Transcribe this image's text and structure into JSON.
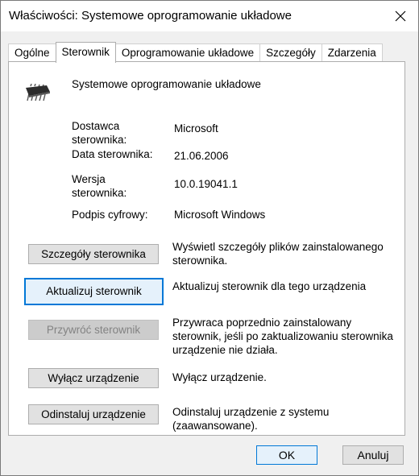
{
  "window": {
    "title": "Właściwości: Systemowe oprogramowanie układowe"
  },
  "tabs": [
    {
      "label": "Ogólne",
      "active": false
    },
    {
      "label": "Sterownik",
      "active": true
    },
    {
      "label": "Oprogramowanie układowe",
      "active": false
    },
    {
      "label": "Szczegóły",
      "active": false
    },
    {
      "label": "Zdarzenia",
      "active": false
    }
  ],
  "device": {
    "name": "Systemowe oprogramowanie układowe",
    "icon": "chip-icon"
  },
  "properties": {
    "provider_label_line1": "Dostawca",
    "provider_label_line2": "sterownika:",
    "provider_value": "Microsoft",
    "date_label": "Data sterownika:",
    "date_value": "21.06.2006",
    "version_label_line1": "Wersja",
    "version_label_line2": "sterownika:",
    "version_value": "10.0.19041.1",
    "signer_label": "Podpis cyfrowy:",
    "signer_value": "Microsoft Windows"
  },
  "actions": {
    "details_label": "Szczegóły sterownika",
    "details_desc_line1": "Wyświetl szczegóły plików zainstalowanego",
    "details_desc_line2": "sterownika.",
    "update_label": "Aktualizuj sterownik",
    "update_desc": "Aktualizuj sterownik dla tego urządzenia",
    "rollback_label": "Przywróć sterownik",
    "rollback_desc_line1": "Przywraca poprzednio zainstalowany",
    "rollback_desc_line2": "sterownik, jeśli po zaktualizowaniu sterownika",
    "rollback_desc_line3": "urządzenie nie działa.",
    "disable_label": "Wyłącz urządzenie",
    "disable_desc": "Wyłącz urządzenie.",
    "uninstall_label": "Odinstaluj urządzenie",
    "uninstall_desc_line1": "Odinstaluj urządzenie z systemu",
    "uninstall_desc_line2": "(zaawansowane)."
  },
  "footer": {
    "ok_label": "OK",
    "cancel_label": "Anuluj"
  },
  "colors": {
    "focus": "#0078d7",
    "window_bg": "#f0f0f0",
    "panel_bg": "#ffffff"
  }
}
